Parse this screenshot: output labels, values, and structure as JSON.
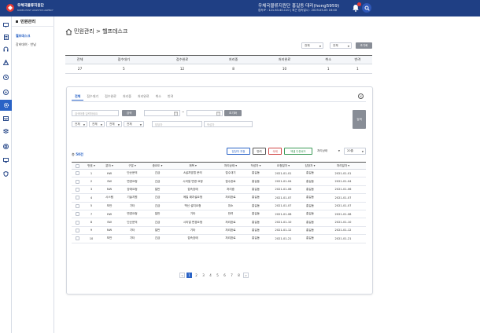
{
  "header": {
    "brand": "우체국물류지원단",
    "brand_sub": "KOREA POST LOGISTICS AGENCY",
    "user_name": "우체국물류지원단 홍길동 대리(hong5959)",
    "user_info": "접속IP : 121.63.40.110  |  최근 접속일시 : 2019-05-05  16:40"
  },
  "iconbar": {
    "icons": [
      "monitor-icon",
      "document-icon",
      "headset-icon",
      "warning-icon",
      "clock-icon",
      "settings-icon",
      "gear-icon",
      "inbox-icon",
      "stack-icon",
      "target-icon",
      "screen-icon",
      "shield-icon"
    ],
    "active_index": 6
  },
  "sidemenu": {
    "title": "민원관리",
    "items": [
      "헬프데스크",
      "장비대여 · 반납"
    ]
  },
  "page": {
    "title": "민원관리 > 헬프데스크"
  },
  "filters_top": {
    "select1": "전체",
    "select2": "전체",
    "reset": "초기화"
  },
  "stats": {
    "headers": [
      "전체",
      "접수대기",
      "접수완료",
      "처리중",
      "처리완료",
      "취소",
      "반려"
    ],
    "values": [
      "27",
      "5",
      "12",
      "8",
      "10",
      "1",
      "1"
    ]
  },
  "tabs": [
    "전체",
    "접수대기",
    "접수완료",
    "처리중",
    "처리완료",
    "취소",
    "반려"
  ],
  "search": {
    "keyword_placeholder": "검색어를 입력하세요",
    "search_button": "검색",
    "tilde": "~",
    "reset_button": "초기화",
    "select_all_1": "전체",
    "select_all_2": "전체",
    "select_all_3": "전체",
    "select_all_4": "전체",
    "manager_placeholder": "담당자",
    "writer_placeholder": "작성자",
    "big_search": "검색"
  },
  "list_actions": {
    "total_prefix": "총 ",
    "total_count": "50건",
    "assign": "담당자 지정",
    "reject": "반려",
    "delete": "삭제",
    "excel": "엑셀 다운로드",
    "status_select": "처리상태",
    "page_size": "20줄"
  },
  "table": {
    "headers": [
      "번호",
      "분야",
      "구분",
      "중요도",
      "제목",
      "처리상태",
      "작성자",
      "요청일자",
      "담당자",
      "처리일자"
    ],
    "rows": [
      [
        "1",
        "HW",
        "단순문의",
        "긴급",
        "A설치방법 문의",
        "접수대기",
        "홍길동",
        "2021-01-01",
        "홍길동",
        "2021-01-01"
      ],
      [
        "2",
        "SW",
        "변경요청",
        "긴급",
        "시리얼 변경 요청",
        "접수완료",
        "홍길동",
        "2021-01-04",
        "홍길동",
        "2021-01-04"
      ],
      [
        "3",
        "NW",
        "장애요청",
        "일반",
        "접속장애",
        "처리중",
        "홍길동",
        "2021-01-06",
        "홍길동",
        "2021-01-06"
      ],
      [
        "4",
        "시스템",
        "기술지원",
        "긴급",
        "메일 패치설요청",
        "처리완료",
        "홍길동",
        "2021-01-07",
        "홍길동",
        "2021-01-07"
      ],
      [
        "5",
        "보안",
        "기타",
        "긴급",
        "백신 설치요청",
        "취소",
        "홍길동",
        "2021-01-07",
        "홍길동",
        "2021-01-07"
      ],
      [
        "7",
        "HW",
        "변경요청",
        "일반",
        "기타",
        "반려",
        "홍길동",
        "2021-01-08",
        "홍길동",
        "2021-01-08"
      ],
      [
        "8",
        "SW",
        "단순문의",
        "긴급",
        "시리얼 변경요청",
        "처리완료",
        "홍길동",
        "2021-01-10",
        "홍길동",
        "2021-01-10"
      ],
      [
        "9",
        "NW",
        "기타",
        "일반",
        "기타",
        "처리완료",
        "홍길동",
        "2021-01-12",
        "홍길동",
        "2021-01-12"
      ],
      [
        "10",
        "보안",
        "기타",
        "긴급",
        "접속장애",
        "처리완료",
        "홍길동",
        "2021-01-21",
        "홍길동",
        "2021-01-21"
      ]
    ]
  },
  "pagination": {
    "prev": "<",
    "next": ">",
    "pages": [
      "1",
      "2",
      "3",
      "4",
      "5",
      "6",
      "7",
      "8"
    ],
    "current": "1"
  },
  "colors": {
    "header_bg": "#1f3f84",
    "accent": "#2a63c6",
    "delete": "#d04848",
    "excel": "#3b9a57"
  }
}
